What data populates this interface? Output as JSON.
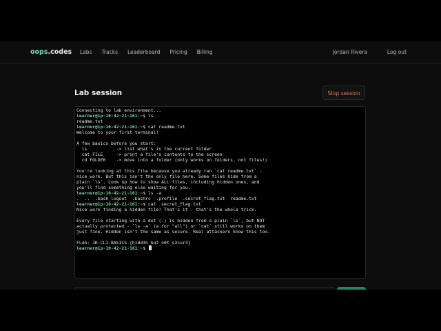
{
  "nav": {
    "brand_a": "oops",
    "brand_b": ".codes",
    "links": [
      "Labs",
      "Tracks",
      "Leaderboard",
      "Pricing",
      "Billing"
    ],
    "user": "Jordan Rivera",
    "logout": "Log out"
  },
  "session": {
    "title": "Lab session",
    "stop_button": "Stop session"
  },
  "terminal": {
    "lines": [
      {
        "text": "Connecting to lab environment..."
      },
      {
        "prompt": "learner@ip-10-42-21-161",
        "text": ":~$ ls"
      },
      {
        "text": "readme.txt"
      },
      {
        "prompt": "learner@ip-10-42-21-161",
        "text": ":~$ cat readme.txt"
      },
      {
        "text": "Welcome to your first terminal!"
      },
      {
        "text": ""
      },
      {
        "text": "A few basics before you start:"
      },
      {
        "text": "  ls           -> list what's in the current folder"
      },
      {
        "text": "  cat FILE     -> print a file's contents to the screen"
      },
      {
        "text": "  cd FOLDER    -> move into a folder (only works on folders, not files!)"
      },
      {
        "text": ""
      },
      {
        "text": "You're looking at this file because you already ran `cat readme.txt` -"
      },
      {
        "text": "nice work. But this isn't the only file here. Some files hide from a"
      },
      {
        "text": "plain `ls`. Look up how to show ALL files, including hidden ones, and"
      },
      {
        "text": "you'll find something else waiting for you."
      },
      {
        "prompt": "learner@ip-10-42-21-161",
        "text": ":~$ ls -a"
      },
      {
        "text": ".  ..  .bash_logout  .bashrc  .profile  .secret_flag.txt  readme.txt"
      },
      {
        "prompt": "learner@ip-10-42-21-161",
        "text": ":~$ cat .secret_flag.txt"
      },
      {
        "text": "Nice work finding a hidden file! That's it - that's the whole trick."
      },
      {
        "text": ""
      },
      {
        "text": "Every file starting with a dot (.) is hidden from a plain `ls`, but NOT"
      },
      {
        "text": "actually protected - `ls -a` (a for \"all\") or `cat` still works on them"
      },
      {
        "text": "just fine. Hidden isn't the same as secure. Real attackers know this too."
      },
      {
        "text": ""
      },
      {
        "text": "FLAG: JR-CLI-BASICS-{h1dd3n_but_n0t_s3cur3}"
      },
      {
        "prompt": "learner@ip-10-42-21-161",
        "text": ":~$ ",
        "cursor": true
      }
    ]
  },
  "colors": {
    "accent": "#7fd7a8",
    "danger": "#e07a68",
    "run_button": "#1d8a63"
  }
}
